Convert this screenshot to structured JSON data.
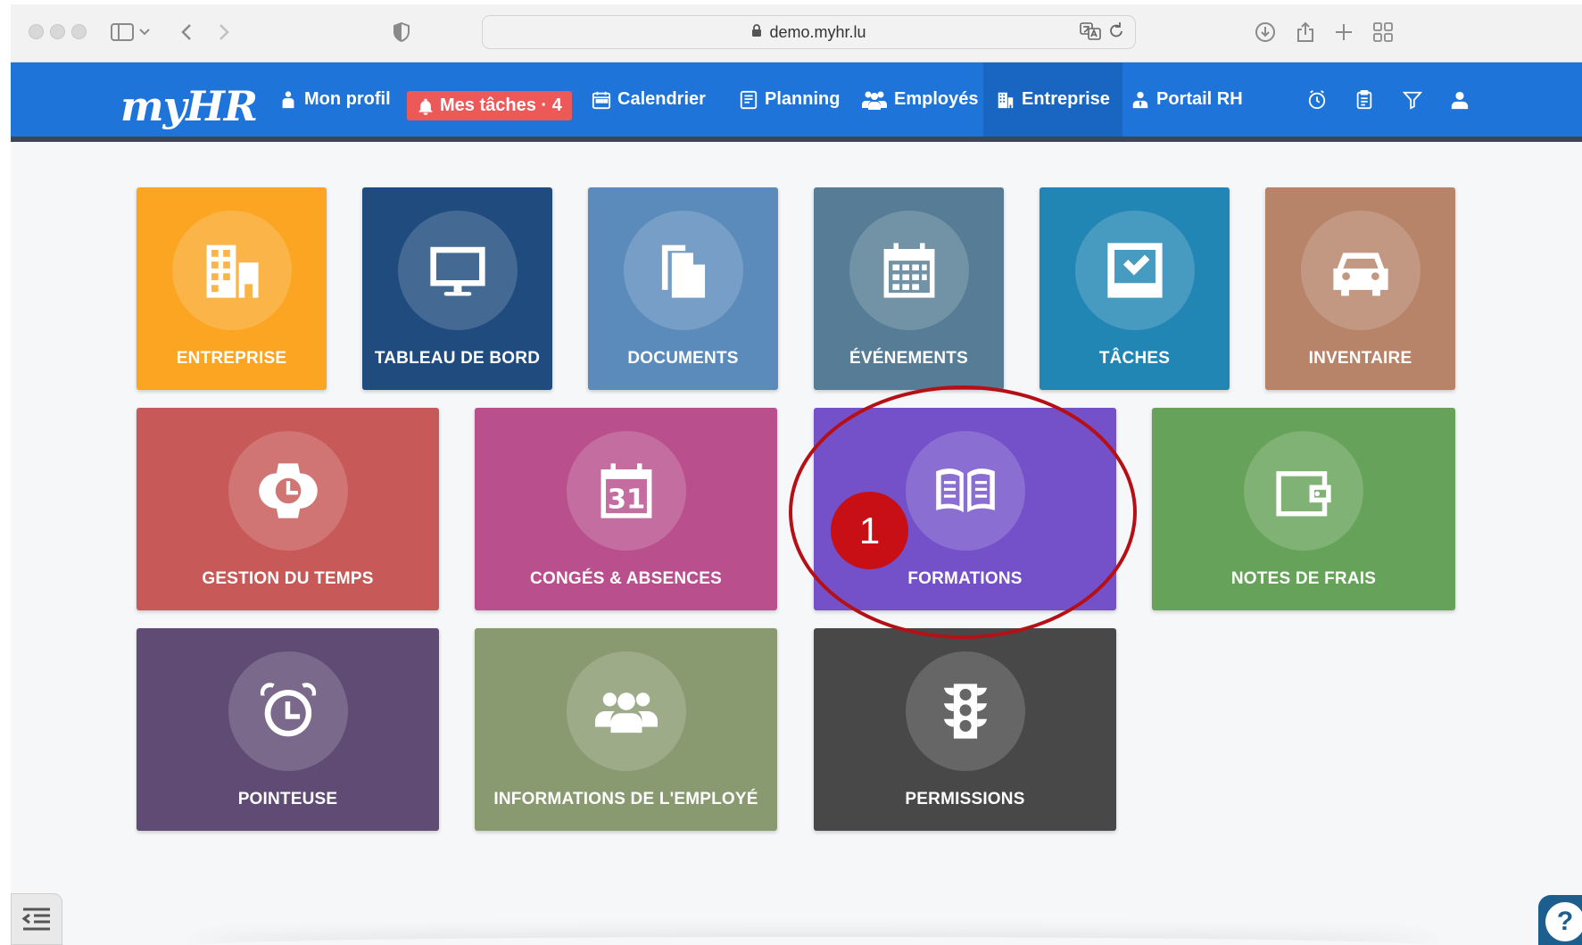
{
  "browser": {
    "url": "demo.myhr.lu"
  },
  "navbar": {
    "logo": "myHR",
    "items": [
      {
        "label": "Mon profil"
      },
      {
        "label": "Mes tâches · 4"
      },
      {
        "label": "Calendrier"
      },
      {
        "label": "Planning"
      },
      {
        "label": "Employés"
      },
      {
        "label": "Entreprise"
      },
      {
        "label": "Portail RH"
      }
    ],
    "accent": "#1e74d8",
    "active_item": "Entreprise"
  },
  "tiles": [
    {
      "label": "ENTREPRISE",
      "color": "#fba523",
      "icon": "building-icon"
    },
    {
      "label": "TABLEAU DE BORD",
      "color": "#1f4b7e",
      "icon": "monitor-icon"
    },
    {
      "label": "DOCUMENTS",
      "color": "#5b8bbb",
      "icon": "documents-icon"
    },
    {
      "label": "ÉVÉNEMENTS",
      "color": "#567d95",
      "icon": "calendar-icon"
    },
    {
      "label": "TÂCHES",
      "color": "#2286b4",
      "icon": "task-check-icon"
    },
    {
      "label": "INVENTAIRE",
      "color": "#b7846a",
      "icon": "car-icon"
    },
    {
      "label": "GESTION DU TEMPS",
      "color": "#c75958",
      "icon": "watch-icon"
    },
    {
      "label": "CONGÉS & ABSENCES",
      "color": "#b9508d",
      "icon": "calendar-31-icon"
    },
    {
      "label": "FORMATIONS",
      "color": "#7451c8",
      "icon": "open-book-icon"
    },
    {
      "label": "NOTES DE FRAIS",
      "color": "#67a25a",
      "icon": "wallet-icon"
    },
    {
      "label": "POINTEUSE",
      "color": "#5f4b74",
      "icon": "alarm-clock-icon"
    },
    {
      "label": "INFORMATIONS DE L'EMPLOYÉ",
      "color": "#8a9a70",
      "icon": "users-icon"
    },
    {
      "label": "PERMISSIONS",
      "color": "#484848",
      "icon": "traffic-light-icon"
    }
  ],
  "annotation": {
    "marker": "1",
    "color": "#c80f16"
  },
  "help": {
    "label": "?"
  }
}
